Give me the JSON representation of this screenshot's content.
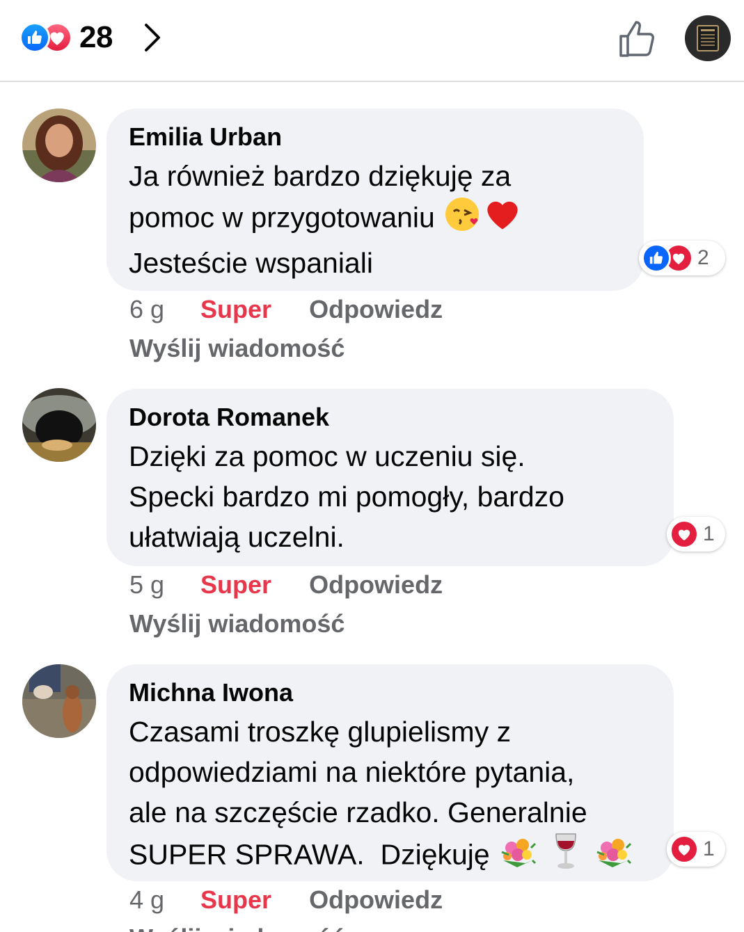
{
  "header": {
    "reaction_count": "28",
    "icons": [
      "like-icon",
      "love-icon",
      "chevron-right-icon",
      "thumbs-up-icon",
      "book-icon"
    ]
  },
  "comments": [
    {
      "author": "Emilia Urban",
      "lines": [
        "Ja również bardzo dziękuję za",
        "pomoc w przygotowaniu",
        "Jesteście wspaniali"
      ],
      "emoji": [
        "kissing-face-emoji",
        "red-heart-emoji"
      ],
      "reaction_count": "2",
      "reactions": [
        "like",
        "love"
      ],
      "time": "6 g",
      "super_label": "Super",
      "reply_label": "Odpowiedz",
      "send_label": "Wyślij wiadomość"
    },
    {
      "author": "Dorota Romanek",
      "lines": [
        "Dzięki za pomoc w uczeniu się.",
        "Specki bardzo mi pomogły, bardzo",
        "ułatwiają uczelni."
      ],
      "reaction_count": "1",
      "reactions": [
        "love"
      ],
      "time": "5 g",
      "super_label": "Super",
      "reply_label": "Odpowiedz",
      "send_label": "Wyślij wiadomość"
    },
    {
      "author": "Michna Iwona",
      "lines": [
        "Czasami troszkę glupielismy z",
        "odpowiedziami na niektóre pytania,",
        "ale na szczęście rzadko. Generalnie",
        "SUPER SPRAWA.  Dziękuję"
      ],
      "emoji": [
        "bouquet-emoji",
        "wine-glass-emoji",
        "bouquet-emoji"
      ],
      "reaction_count": "1",
      "reactions": [
        "love"
      ],
      "time": "4 g",
      "super_label": "Super",
      "reply_label": "Odpowiedz",
      "send_label": "Wyślij wiadomość"
    }
  ],
  "colors": {
    "like_blue": "#0866ff",
    "love_red": "#e41e3f",
    "super_red": "#e8364b",
    "bubble_bg": "#f0f2f5",
    "meta_gray": "#65676b"
  }
}
